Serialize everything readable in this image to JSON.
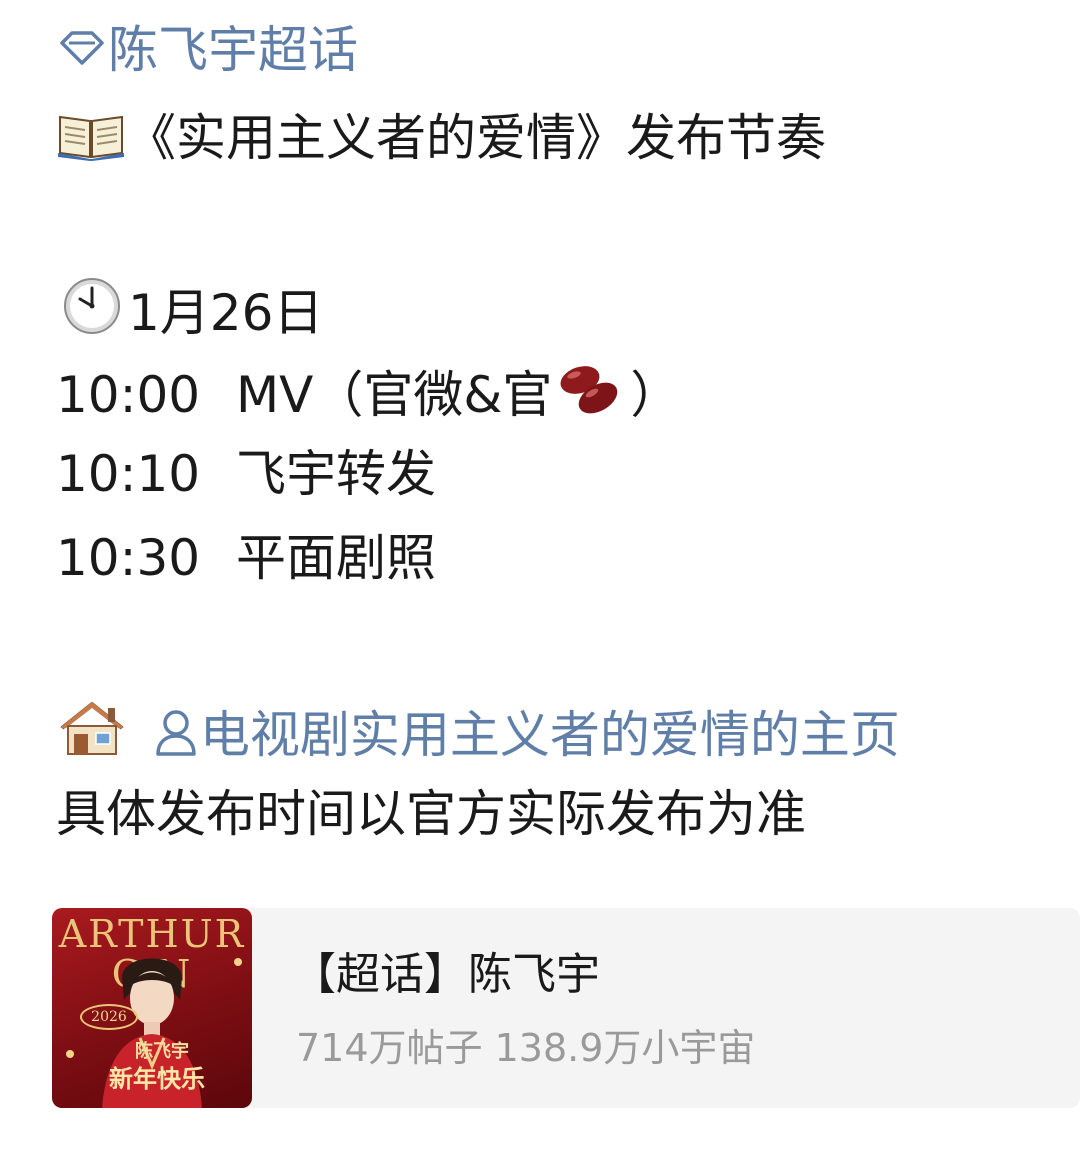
{
  "post": {
    "supertopic_link": "陈飞宇超话",
    "title": "《实用主义者的爱情》发布节奏",
    "date": "1月26日",
    "schedule": [
      {
        "time": "10:00",
        "event_prefix": "MV（官微&官",
        "event_suffix": "）"
      },
      {
        "time": "10:10",
        "event": "飞宇转发"
      },
      {
        "time": "10:30",
        "event": "平面剧照"
      }
    ],
    "homepage_link": "电视剧实用主义者的爱情的主页",
    "note": "具体发布时间以官方实际发布为准"
  },
  "card": {
    "title": "【超话】陈飞宇",
    "stats": "714万帖子 138.9万小宇宙",
    "thumbnail": {
      "letters_top": "ARTHUR",
      "letters_bottom": "C   N",
      "year": "2026",
      "name": "陈飞宇",
      "greeting": "新年快乐"
    }
  },
  "icons": {
    "supertopic": "diamond-outline-icon",
    "book": "open-book-icon",
    "clock": "clock-icon",
    "beans": "red-beans-icon",
    "house": "house-icon",
    "user": "user-outline-icon"
  },
  "colors": {
    "link": "#5f7fa9",
    "text": "#1a1a1a",
    "secondary_text": "#9a9a9a",
    "card_background": "#f4f4f4",
    "thumbnail_red": "#a91a1f",
    "thumbnail_gold": "#e9c57a"
  }
}
